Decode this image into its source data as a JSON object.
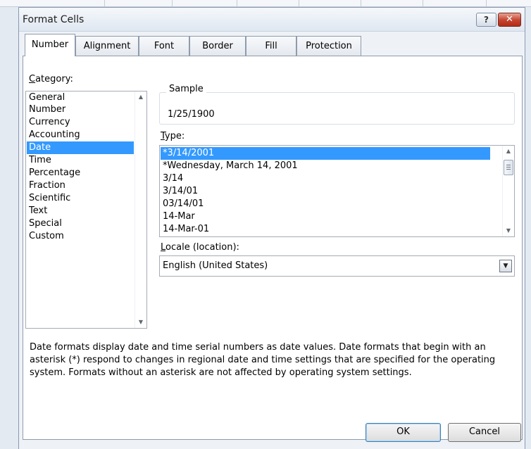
{
  "window": {
    "title": "Format Cells",
    "help_label": "?",
    "close_label": "✕"
  },
  "tabs": [
    {
      "label": "Number",
      "active": true
    },
    {
      "label": "Alignment",
      "active": false
    },
    {
      "label": "Font",
      "active": false
    },
    {
      "label": "Border",
      "active": false
    },
    {
      "label": "Fill",
      "active": false
    },
    {
      "label": "Protection",
      "active": false
    }
  ],
  "category": {
    "label_mnemonic": "C",
    "label_rest": "ategory:",
    "items": [
      "General",
      "Number",
      "Currency",
      "Accounting",
      "Date",
      "Time",
      "Percentage",
      "Fraction",
      "Scientific",
      "Text",
      "Special",
      "Custom"
    ],
    "selected": "Date"
  },
  "sample": {
    "label": "Sample",
    "value": "1/25/1900"
  },
  "type": {
    "label_mnemonic": "T",
    "label_rest": "ype:",
    "items": [
      "*3/14/2001",
      "*Wednesday, March 14, 2001",
      "3/14",
      "3/14/01",
      "03/14/01",
      "14-Mar",
      "14-Mar-01"
    ],
    "selected": "*3/14/2001"
  },
  "locale": {
    "label_mnemonic": "L",
    "label_rest": "ocale (location):",
    "value": "English (United States)"
  },
  "description": "Date formats display date and time serial numbers as date values.  Date formats that begin with an asterisk (*) respond to changes in regional date and time settings that are specified for the operating system. Formats without an asterisk are not affected by operating system settings.",
  "buttons": {
    "ok": "OK",
    "cancel": "Cancel"
  },
  "icons": {
    "scroll_up": "scroll-up-arrow-icon",
    "scroll_down": "scroll-down-arrow-icon",
    "dropdown": "chevron-down-icon",
    "help": "help-icon",
    "close": "close-icon"
  },
  "colors": {
    "selection": "#3399ff",
    "close_button": "#c4422e"
  }
}
